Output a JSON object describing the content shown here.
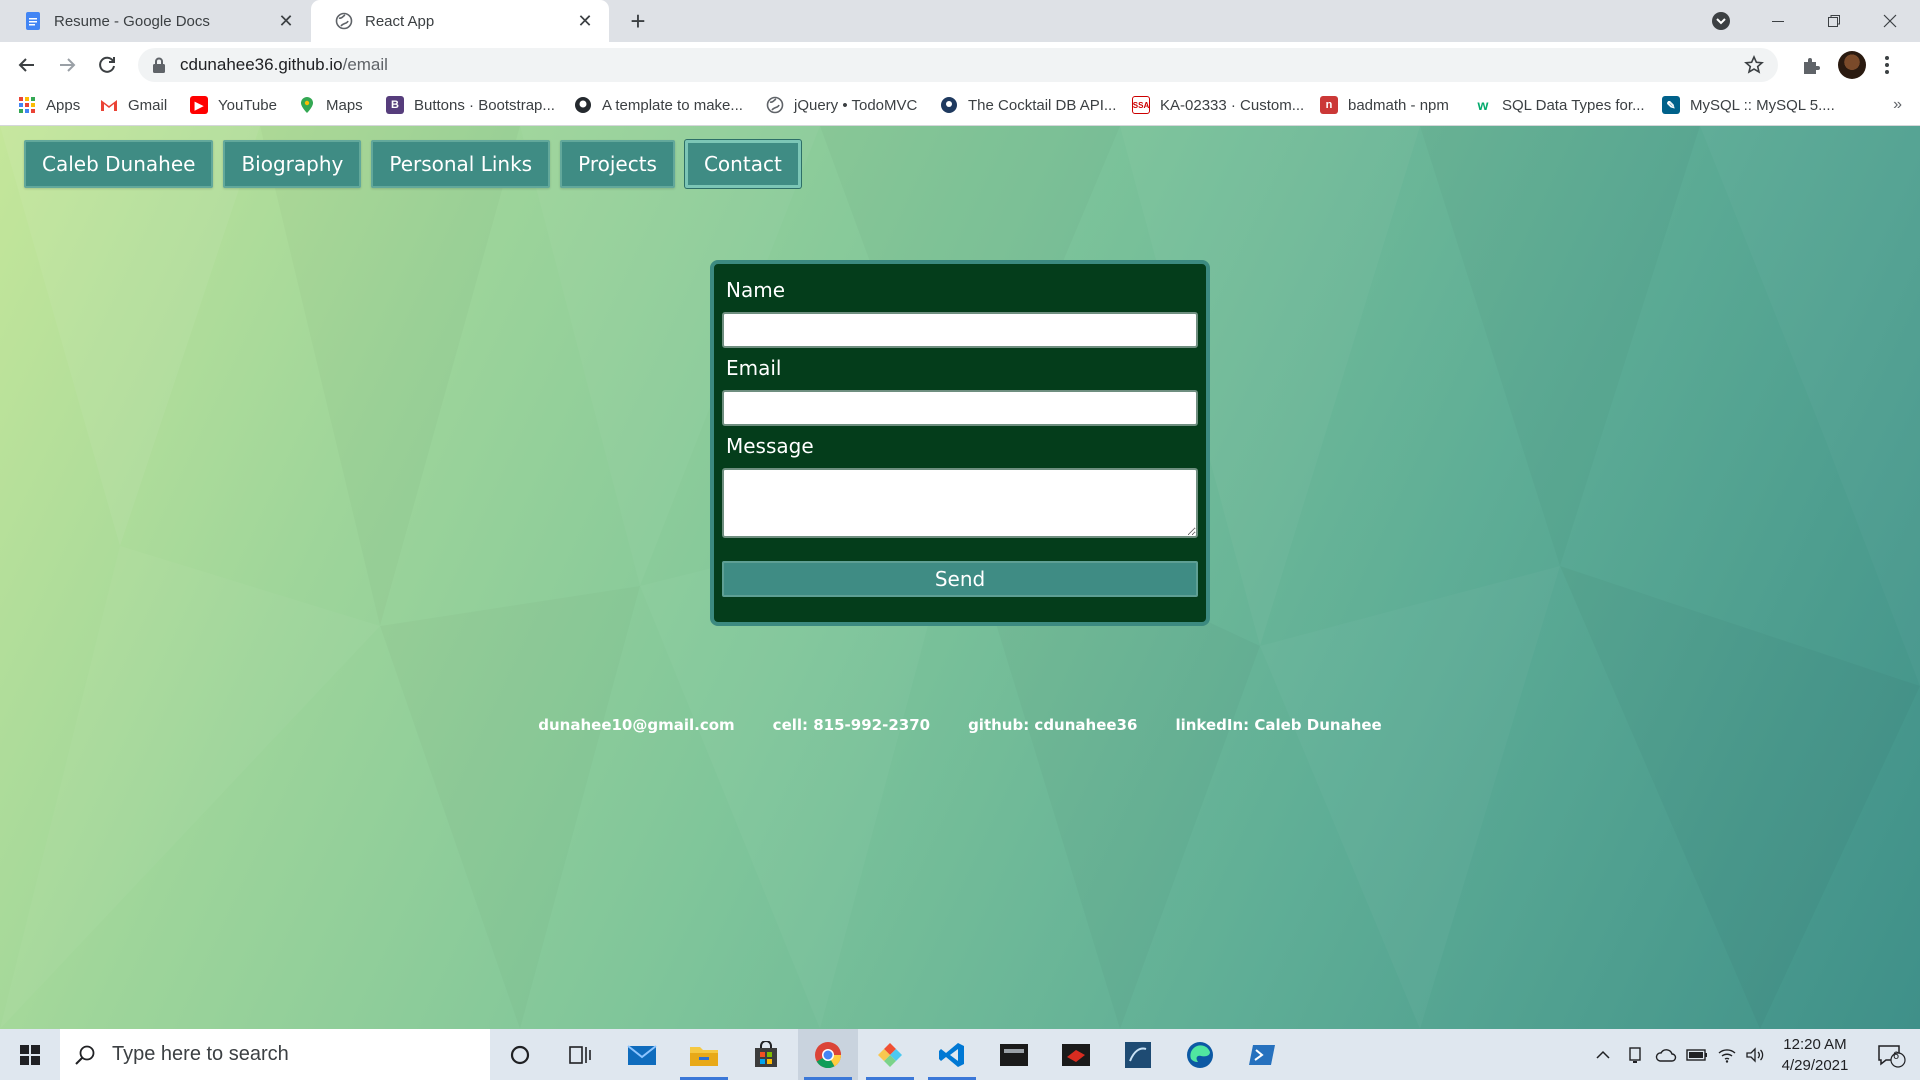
{
  "browser": {
    "tabs": [
      {
        "title": "Resume - Google Docs",
        "active": false
      },
      {
        "title": "React App",
        "active": true
      }
    ],
    "url": {
      "host": "cdunahee36.github.io",
      "path": "/email"
    },
    "bookmarks": [
      {
        "label": "Apps",
        "icon": "apps-grid-icon"
      },
      {
        "label": "Gmail",
        "icon": "gmail-icon"
      },
      {
        "label": "YouTube",
        "icon": "youtube-icon"
      },
      {
        "label": "Maps",
        "icon": "maps-icon"
      },
      {
        "label": "Buttons · Bootstrap...",
        "icon": "bootstrap-icon"
      },
      {
        "label": "A template to make...",
        "icon": "github-icon"
      },
      {
        "label": "jQuery • TodoMVC",
        "icon": "globe-icon"
      },
      {
        "label": "The Cocktail DB API...",
        "icon": "cocktaildb-icon"
      },
      {
        "label": "KA-02333 · Custom...",
        "icon": "ssa-icon"
      },
      {
        "label": "badmath - npm",
        "icon": "npm-icon"
      },
      {
        "label": "SQL Data Types for...",
        "icon": "w3schools-icon"
      },
      {
        "label": "MySQL :: MySQL 5....",
        "icon": "mysql-icon"
      }
    ]
  },
  "page": {
    "nav": [
      {
        "label": "Caleb Dunahee"
      },
      {
        "label": "Biography"
      },
      {
        "label": "Personal Links"
      },
      {
        "label": "Projects"
      },
      {
        "label": "Contact"
      }
    ],
    "form": {
      "name_label": "Name",
      "name_value": "",
      "email_label": "Email",
      "email_value": "",
      "message_label": "Message",
      "message_value": "",
      "send_label": "Send"
    },
    "contact": {
      "email": "dunahee10@gmail.com",
      "cell": "cell: 815-992-2370",
      "github": "github: cdunahee36",
      "linkedin": "linkedIn: Caleb Dunahee"
    },
    "colors": {
      "nav_button": "#3f8c84",
      "form_background": "#043d1b",
      "form_border": "#3c8a80"
    }
  },
  "taskbar": {
    "search_placeholder": "Type here to search",
    "apps": [
      "cortana-icon",
      "task-view-icon",
      "mail-icon",
      "file-explorer-icon",
      "store-icon",
      "chrome-icon",
      "git-kraken-icon",
      "vscode-icon",
      "mysql-workbench-icon",
      "redis-icon",
      "mysql-shell-icon",
      "edge-icon",
      "powershell-icon"
    ],
    "time": "12:20 AM",
    "date": "4/29/2021",
    "notification_count": "6"
  }
}
